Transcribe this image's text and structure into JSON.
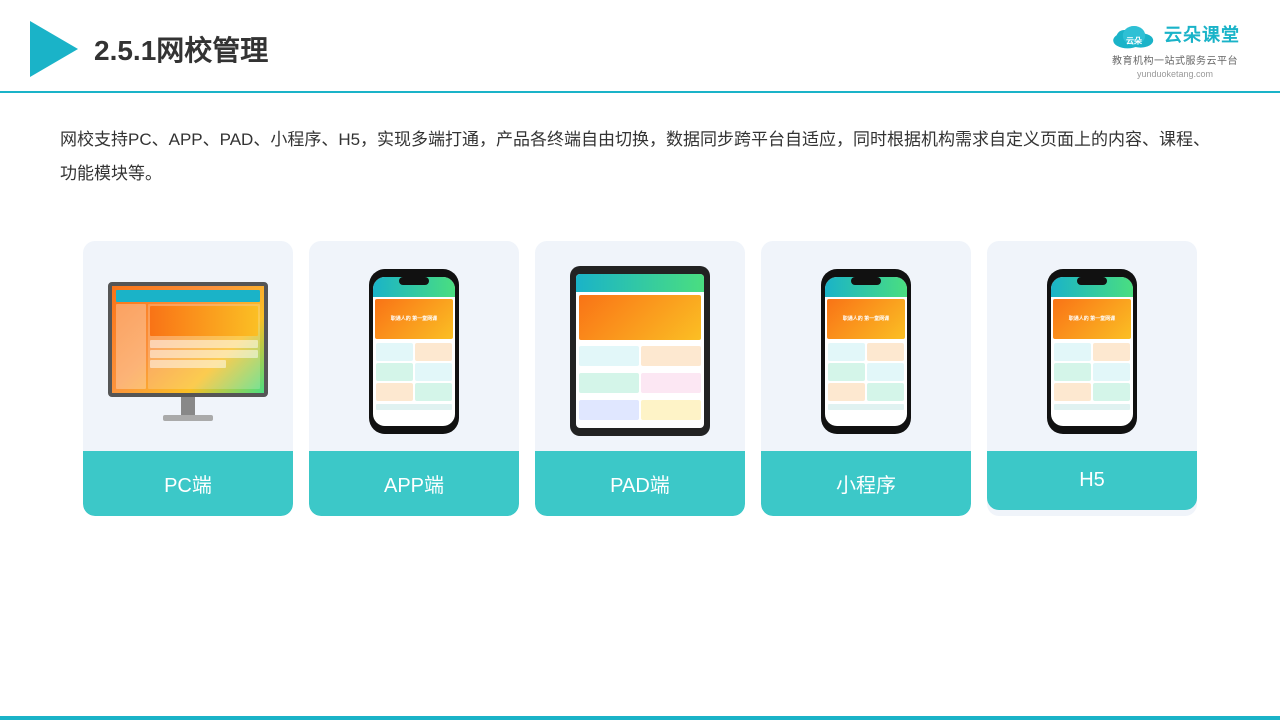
{
  "header": {
    "title": "2.5.1网校管理",
    "brand_name": "云朵课堂",
    "brand_sub": "教育机构一站\n式服务云平台",
    "brand_url": "yunduoketang.com"
  },
  "description": {
    "text": "网校支持PC、APP、PAD、小程序、H5，实现多端打通，产品各终端自由切换，数据同步跨平台自适应，同时根据机构需求自定义页面上的内容、课程、功能模块等。"
  },
  "cards": [
    {
      "id": "pc",
      "label": "PC端"
    },
    {
      "id": "app",
      "label": "APP端"
    },
    {
      "id": "pad",
      "label": "PAD端"
    },
    {
      "id": "miniprogram",
      "label": "小程序"
    },
    {
      "id": "h5",
      "label": "H5"
    }
  ],
  "phone_banner": "职通人的\n第一堂网课"
}
